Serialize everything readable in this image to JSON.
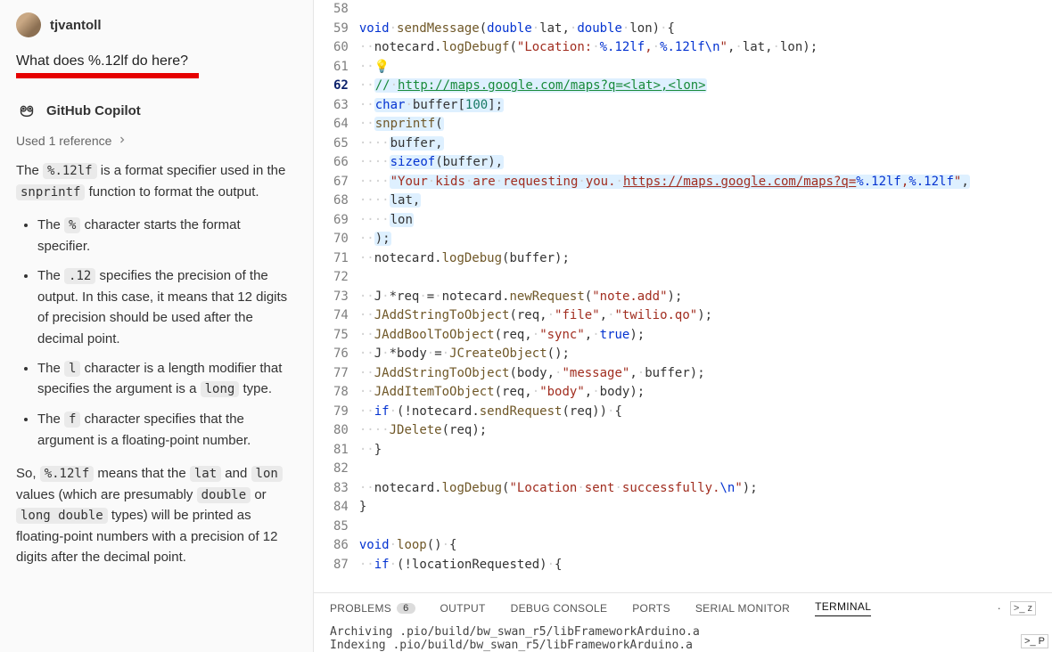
{
  "sidebar": {
    "username": "tjvantoll",
    "question": "What does %.12lf do here?",
    "copilot_name": "GitHub Copilot",
    "references": "Used 1 reference",
    "intro_before": "The ",
    "code1": "%.12lf",
    "intro_mid1": " is a format specifier used in the ",
    "code2": "snprintf",
    "intro_after": " function to format the output.",
    "bullets": [
      {
        "pre": "The ",
        "code": "%",
        "post": " character starts the format specifier."
      },
      {
        "pre": "The ",
        "code": ".12",
        "post": " specifies the precision of the output. In this case, it means that 12 digits of precision should be used after the decimal point."
      },
      {
        "pre": "The ",
        "code": "l",
        "post": " character is a length modifier that specifies the argument is a ",
        "code2": "long",
        "post2": " type."
      },
      {
        "pre": "The ",
        "code": "f",
        "post": " character specifies that the argument is a floating-point number."
      }
    ],
    "closing_pre": "So, ",
    "c1": "%.12lf",
    "closing_mid1": " means that the ",
    "c2": "lat",
    "closing_mid2": " and ",
    "c3": "lon",
    "closing_mid3": " values (which are presumably ",
    "c4": "double",
    "closing_mid4": " or ",
    "c5": "long double",
    "closing_mid5": " types) will be printed as floating-point numbers with a precision of 12 digits after the decimal point."
  },
  "editor": {
    "line_start": 58,
    "line_end": 87,
    "highlighted_line": 62,
    "url_comment": "http://maps.google.com/maps?q=<lat>,<lon>",
    "maps_url": "https://maps.google.com/maps?q=",
    "format_specifier": "%.12lf",
    "log_success": "Location sent successfully.\\n",
    "file_name": "twilio.qo",
    "note_add": "note.add"
  },
  "panel": {
    "tabs": {
      "problems": "PROBLEMS",
      "problems_count": "6",
      "output": "OUTPUT",
      "debug_console": "DEBUG CONSOLE",
      "ports": "PORTS",
      "serial_monitor": "SERIAL MONITOR",
      "terminal": "TERMINAL"
    },
    "terminal": {
      "line1": "Archiving .pio/build/bw_swan_r5/libFrameworkArduino.a",
      "line2": "Indexing .pio/build/bw_swan_r5/libFrameworkArduino.a"
    },
    "icon_labels": {
      "z": "z",
      "p": "P"
    }
  }
}
